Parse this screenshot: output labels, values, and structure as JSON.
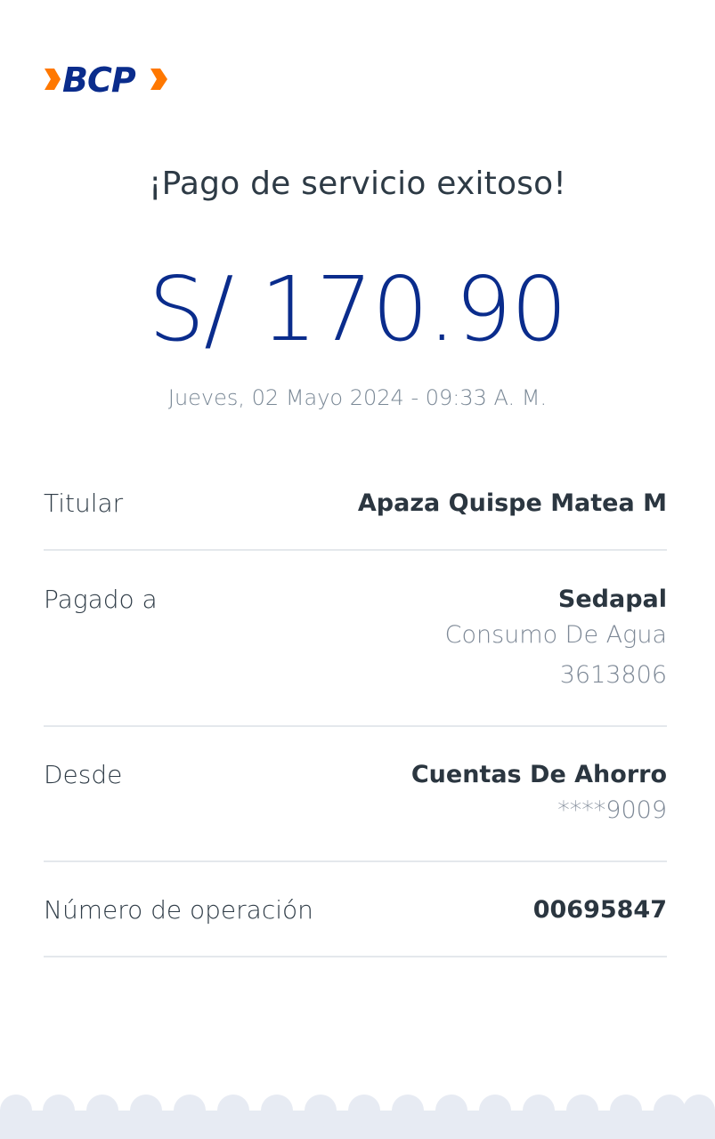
{
  "brand": {
    "logo_text": "BCP"
  },
  "receipt": {
    "title": "¡Pago de servicio exitoso!",
    "amount": "S/ 170.90",
    "datetime": "Jueves, 02 Mayo 2024 - 09:33 A. M."
  },
  "details": {
    "titular": {
      "label": "Titular",
      "value": "Apaza Quispe Matea M"
    },
    "pagado_a": {
      "label": "Pagado a",
      "value": "Sedapal",
      "line2": "Consumo De Agua",
      "line3": "3613806"
    },
    "desde": {
      "label": "Desde",
      "value": "Cuentas De Ahorro",
      "line2": "****9009"
    },
    "operacion": {
      "label": "Número de operación",
      "value": "00695847"
    }
  },
  "colors": {
    "brand_blue": "#0a2c8c",
    "brand_orange": "#ff7800",
    "text_dark": "#2d3a45",
    "text_muted": "#7a8896",
    "divider": "#e4e8ec",
    "footer_band": "#e7ebf3"
  }
}
